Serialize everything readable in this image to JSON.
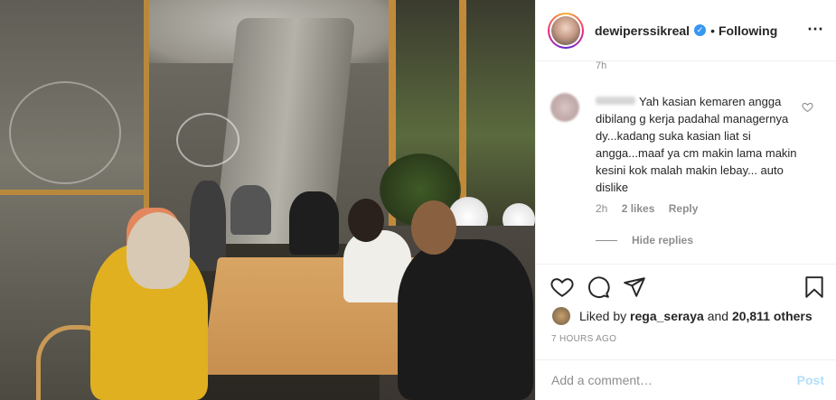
{
  "header": {
    "username": "dewiperssikreal",
    "verified_mark": "✓",
    "separator": "•",
    "follow_status": "Following",
    "more_icon": "⋯"
  },
  "previous_comment_time": "7h",
  "comment": {
    "text": "Yah kasian kemaren angga dibilang g kerja padahal managernya dy...kadang suka kasian liat si angga...maaf ya cm makin lama makin kesini kok malah makin lebay... auto dislike",
    "time": "2h",
    "likes": "2 likes",
    "reply_label": "Reply",
    "hide_replies_label": "Hide replies"
  },
  "actions": {
    "icons": [
      "heart-icon",
      "comment-icon",
      "share-icon",
      "bookmark-icon"
    ]
  },
  "likes": {
    "prefix": "Liked by ",
    "user": "rega_seraya",
    "middle": " and ",
    "others": "20,811 others"
  },
  "post_time": "7 HOURS AGO",
  "add_comment": {
    "placeholder": "Add a comment…",
    "post_label": "Post"
  },
  "colors": {
    "verified": "#3897f0",
    "post_button_disabled": "#b2dffc",
    "muted_text": "#8e8e8e"
  }
}
